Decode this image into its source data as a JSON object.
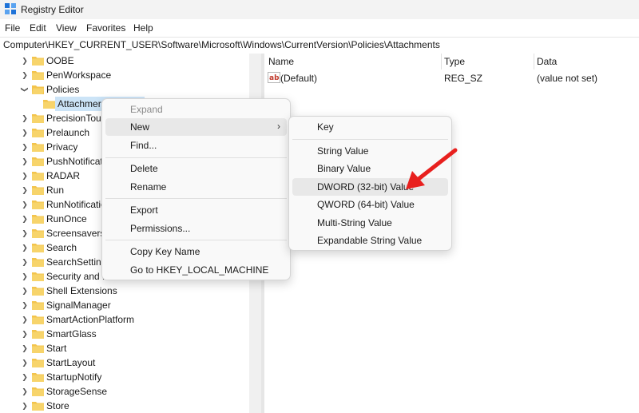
{
  "window": {
    "title": "Registry Editor"
  },
  "menu": [
    "File",
    "Edit",
    "View",
    "Favorites",
    "Help"
  ],
  "address": "Computer\\HKEY_CURRENT_USER\\Software\\Microsoft\\Windows\\CurrentVersion\\Policies\\Attachments",
  "tree": {
    "items": [
      {
        "label": "OOBE",
        "expanded": false
      },
      {
        "label": "PenWorkspace",
        "expanded": false
      },
      {
        "label": "Policies",
        "expanded": true
      },
      {
        "label": "Attachmer",
        "selected": true
      },
      {
        "label": "PrecisionTouc",
        "expanded": false
      },
      {
        "label": "Prelaunch",
        "expanded": false
      },
      {
        "label": "Privacy",
        "expanded": false
      },
      {
        "label": "PushNotificati",
        "expanded": false
      },
      {
        "label": "RADAR",
        "expanded": false
      },
      {
        "label": "Run",
        "expanded": false
      },
      {
        "label": "RunNotificatio",
        "expanded": false
      },
      {
        "label": "RunOnce",
        "expanded": false
      },
      {
        "label": "Screensavers",
        "expanded": false
      },
      {
        "label": "Search",
        "expanded": false
      },
      {
        "label": "SearchSetting",
        "expanded": false
      },
      {
        "label": "Security and M",
        "expanded": false
      },
      {
        "label": "Shell Extensions",
        "expanded": false
      },
      {
        "label": "SignalManager",
        "expanded": false
      },
      {
        "label": "SmartActionPlatform",
        "expanded": false
      },
      {
        "label": "SmartGlass",
        "expanded": false
      },
      {
        "label": "Start",
        "expanded": false
      },
      {
        "label": "StartLayout",
        "expanded": false
      },
      {
        "label": "StartupNotify",
        "expanded": false
      },
      {
        "label": "StorageSense",
        "expanded": false
      },
      {
        "label": "Store",
        "expanded": false
      }
    ]
  },
  "values": {
    "columns": {
      "name": "Name",
      "type": "Type",
      "data": "Data"
    },
    "rows": [
      {
        "name": "(Default)",
        "type": "REG_SZ",
        "data": "(value not set)"
      }
    ]
  },
  "context_menu": {
    "items": [
      {
        "label": "Expand",
        "disabled": true
      },
      {
        "label": "New",
        "has_submenu": true,
        "hover": true
      },
      {
        "label": "Find..."
      },
      {
        "label": "Delete"
      },
      {
        "label": "Rename"
      },
      {
        "label": "Export"
      },
      {
        "label": "Permissions..."
      },
      {
        "label": "Copy Key Name"
      },
      {
        "label": "Go to HKEY_LOCAL_MACHINE"
      }
    ]
  },
  "submenu": {
    "items": [
      {
        "label": "Key"
      },
      {
        "label": "String Value"
      },
      {
        "label": "Binary Value"
      },
      {
        "label": "DWORD (32-bit) Value",
        "hover": true
      },
      {
        "label": "QWORD (64-bit) Value"
      },
      {
        "label": "Multi-String Value"
      },
      {
        "label": "Expandable String Value"
      }
    ]
  },
  "colors": {
    "selection": "#cce4f7",
    "menu_hover": "#e8e8e8",
    "annotation_arrow": "#e8201e",
    "folder": "#f3c44d"
  },
  "icons": {
    "app": "registry-editor-icon",
    "folder": "folder-icon",
    "value": "string-value-ab-icon",
    "submenu_arrow": "chevron-right-icon",
    "annotation": "red-arrow-icon"
  }
}
